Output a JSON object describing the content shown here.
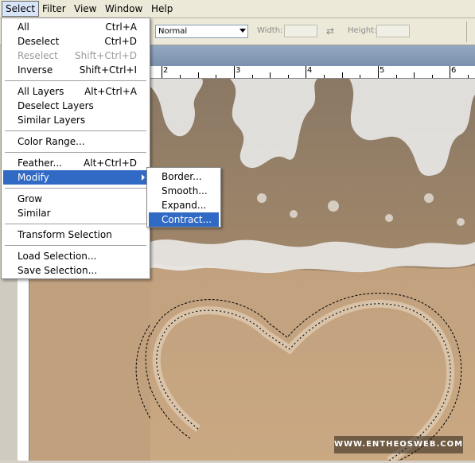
{
  "menubar": {
    "items": [
      {
        "label": "Select",
        "active": true
      },
      {
        "label": "Filter",
        "active": false
      },
      {
        "label": "View",
        "active": false
      },
      {
        "label": "Window",
        "active": false
      },
      {
        "label": "Help",
        "active": false
      }
    ]
  },
  "options": {
    "style_value": "Normal",
    "width_label": "Width:",
    "height_label": "Height:",
    "width_value": "",
    "height_value": ""
  },
  "ruler": {
    "top_numbers": [
      "2",
      "3",
      "4",
      "5",
      "6"
    ]
  },
  "select_menu": {
    "items": [
      {
        "label": "All",
        "shortcut": "Ctrl+A"
      },
      {
        "label": "Deselect",
        "shortcut": "Ctrl+D"
      },
      {
        "label": "Reselect",
        "shortcut": "Shift+Ctrl+D",
        "disabled": true
      },
      {
        "label": "Inverse",
        "shortcut": "Shift+Ctrl+I"
      },
      {
        "label": "All Layers",
        "shortcut": "Alt+Ctrl+A"
      },
      {
        "label": "Deselect Layers",
        "shortcut": ""
      },
      {
        "label": "Similar Layers",
        "shortcut": ""
      },
      {
        "label": "Color Range...",
        "shortcut": ""
      },
      {
        "label": "Feather...",
        "shortcut": "Alt+Ctrl+D"
      },
      {
        "label": "Modify",
        "shortcut": "",
        "highlighted": true,
        "submenu": true
      },
      {
        "label": "Grow",
        "shortcut": ""
      },
      {
        "label": "Similar",
        "shortcut": ""
      },
      {
        "label": "Transform Selection",
        "shortcut": ""
      },
      {
        "label": "Load Selection...",
        "shortcut": ""
      },
      {
        "label": "Save Selection...",
        "shortcut": ""
      }
    ]
  },
  "modify_submenu": {
    "items": [
      {
        "label": "Border..."
      },
      {
        "label": "Smooth..."
      },
      {
        "label": "Expand..."
      },
      {
        "label": "Contract...",
        "highlighted": true
      }
    ]
  },
  "watermark": "WWW.ENTHEOSWEB.COM",
  "colors": {
    "highlight": "#316ac5",
    "menubar_bg": "#ece9d8",
    "sand": "#c6a481",
    "water": "#8c7b66"
  }
}
